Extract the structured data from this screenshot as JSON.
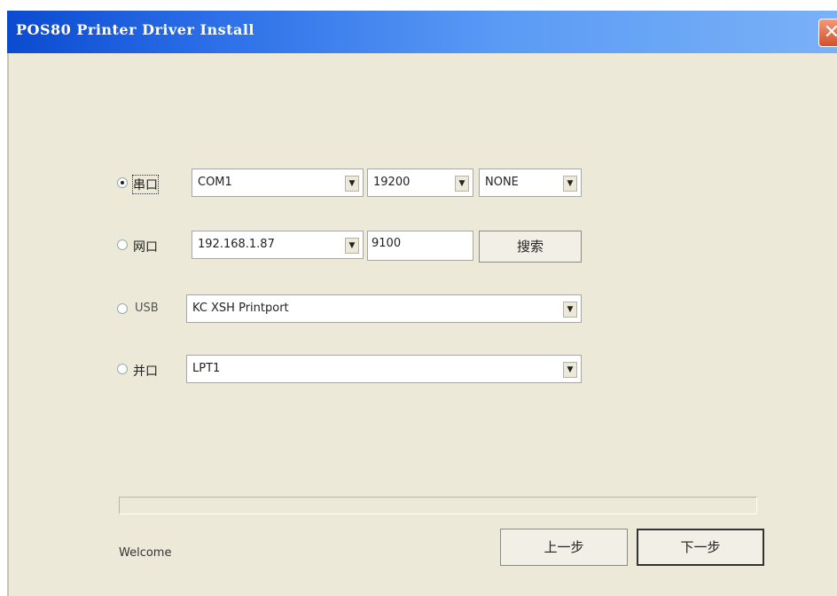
{
  "window": {
    "title": "POS80 Printer Driver Install",
    "close_glyph": "✕"
  },
  "ports": {
    "serial": {
      "label": "串口",
      "port": "COM1",
      "baud": "19200",
      "parity": "NONE",
      "selected": true
    },
    "network": {
      "label": "网口",
      "ip": "192.168.1.87",
      "port": "9100",
      "search_label": "搜索",
      "selected": false
    },
    "usb": {
      "label": "USB",
      "device": "KC XSH Printport",
      "selected": false
    },
    "parallel": {
      "label": "并口",
      "port": "LPT1",
      "selected": false
    }
  },
  "progress": {
    "value": 0
  },
  "status": {
    "text": "Welcome"
  },
  "buttons": {
    "prev": "上一步",
    "next": "下一步"
  },
  "icons": {
    "dropdown": "chevron-down-icon",
    "close": "close-icon"
  },
  "colors": {
    "titlebar_start": "#0a4bd0",
    "client_bg": "#ece9d8",
    "close_bg": "#d2502c"
  }
}
